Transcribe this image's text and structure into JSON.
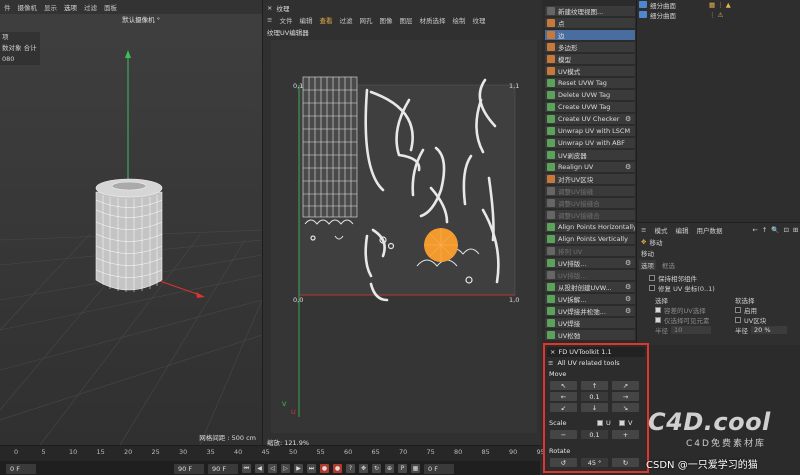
{
  "viewport": {
    "menu": [
      "件",
      "摄像机",
      "显示",
      "选项",
      "过滤",
      "面板"
    ],
    "menu_highlight_index": 3,
    "camera_label": "默认摄像机 °",
    "info_lines": [
      "项",
      "数对象  合计",
      "",
      "080"
    ],
    "grid_label": "网格间距 : 500 cm"
  },
  "timeline": {
    "ticks": [
      "0",
      "5",
      "10",
      "15",
      "20",
      "25",
      "30",
      "35",
      "40",
      "45",
      "50",
      "55",
      "60",
      "65",
      "70",
      "75",
      "80",
      "85",
      "90",
      "95"
    ],
    "start_field": "0 F",
    "end_field_1": "90 F",
    "end_field_2": "90 F",
    "current_field": "0 F"
  },
  "uv_editor": {
    "window_title": "纹理",
    "menu": [
      "文件",
      "编辑",
      "查看",
      "过滤",
      "网孔",
      "图像",
      "图层",
      "材质选择",
      "绘制",
      "纹理"
    ],
    "menu_highlight_index": 2,
    "subtitle": "纹理UV编辑器",
    "corner_tl": "0,1",
    "corner_tr": "1,1",
    "corner_bl": "0,0",
    "corner_br": "1,0",
    "zoom_label": "缩放: 121.9%",
    "axis_u": "U",
    "axis_v": "V"
  },
  "commands": [
    {
      "label": "新建纹理视图...",
      "icon": "grey",
      "state": "normal",
      "gear": false
    },
    {
      "label": "点",
      "icon": "orange",
      "state": "normal",
      "gear": false
    },
    {
      "label": "边",
      "icon": "orange",
      "state": "active",
      "gear": false
    },
    {
      "label": "多边形",
      "icon": "orange",
      "state": "normal",
      "gear": false
    },
    {
      "label": "模型",
      "icon": "orange",
      "state": "normal",
      "gear": false
    },
    {
      "label": "UV模式",
      "icon": "orange",
      "state": "normal",
      "gear": false
    },
    {
      "label": "Reset UVW Tag",
      "icon": "green",
      "state": "normal",
      "gear": false
    },
    {
      "label": "Delete UVW Tag",
      "icon": "green",
      "state": "normal",
      "gear": false
    },
    {
      "label": "Create UVW Tag",
      "icon": "green",
      "state": "normal",
      "gear": false
    },
    {
      "label": "Create UV Checker",
      "icon": "green",
      "state": "normal",
      "gear": true
    },
    {
      "label": "Unwrap UV with LSCM",
      "icon": "green",
      "state": "normal",
      "gear": false
    },
    {
      "label": "Unwrap UV with ABF",
      "icon": "green",
      "state": "normal",
      "gear": false
    },
    {
      "label": "UV剥皮器",
      "icon": "green",
      "state": "normal",
      "gear": false
    },
    {
      "label": "Realign UV",
      "icon": "green",
      "state": "normal",
      "gear": true
    },
    {
      "label": "对齐UV区块",
      "icon": "orange",
      "state": "normal",
      "gear": false
    },
    {
      "label": "调整UV接缝",
      "icon": "grey",
      "state": "disabled",
      "gear": false
    },
    {
      "label": "调整UV接缝合",
      "icon": "grey",
      "state": "disabled",
      "gear": false
    },
    {
      "label": "调整UV接缝合",
      "icon": "grey",
      "state": "disabled",
      "gear": false
    },
    {
      "label": "Align Points Horizontally",
      "icon": "green",
      "state": "normal",
      "gear": false
    },
    {
      "label": "Align Points Vertically",
      "icon": "green",
      "state": "normal",
      "gear": false
    },
    {
      "label": "排列 UV",
      "icon": "grey",
      "state": "disabled",
      "gear": false
    },
    {
      "label": "UV排版...",
      "icon": "green",
      "state": "normal",
      "gear": true
    },
    {
      "label": "UV排版...",
      "icon": "grey",
      "state": "disabled",
      "gear": false
    },
    {
      "label": "从投射创建UVW...",
      "icon": "green",
      "state": "normal",
      "gear": true
    },
    {
      "label": "UV拆解...",
      "icon": "green",
      "state": "normal",
      "gear": true
    },
    {
      "label": "UV焊接并松弛...",
      "icon": "green",
      "state": "normal",
      "gear": true
    },
    {
      "label": "UV焊接",
      "icon": "green",
      "state": "normal",
      "gear": false
    },
    {
      "label": "UV松弛",
      "icon": "green",
      "state": "normal",
      "gear": false
    }
  ],
  "object_manager": {
    "rows": [
      "细分曲面",
      "细分曲面"
    ]
  },
  "attributes": {
    "menu": [
      "模式",
      "编辑",
      "用户数据"
    ],
    "tool_title": "移动",
    "section": "移动",
    "tabs": [
      "选项",
      "框选"
    ],
    "opt1": "保持相邻组件",
    "opt2": "修复 UV 坐标(0..1)",
    "sel_header": "选择",
    "sel_opt1": "容差的UV选择",
    "sel_opt2": "仅选择可见元素",
    "sel_radius_label": "半径",
    "sel_radius_value": "10",
    "right_header": "软选择",
    "right_opt1": "启用",
    "right_opt2": "UV区块",
    "right_radius_label": "半径",
    "right_radius_value": "20 %"
  },
  "toolkit": {
    "title": "FD UVToolkit 1.1",
    "subtitle": "All UV related tools",
    "move_label": "Move",
    "move_value": "0.1",
    "scale_label": "Scale",
    "scale_value": "0.1",
    "scale_u_label": "U",
    "scale_v_label": "V",
    "rotate_label": "Rotate",
    "rotate_value": "45 °",
    "scale_minus": "−"
  },
  "watermark": {
    "main": "C4D.cool",
    "sub": "C4D免费素材库",
    "credit": "CSDN @一只爱学习的猫"
  },
  "colors": {
    "accent_red": "#e0352b",
    "active_blue": "#4a6da0",
    "orange_disc": "#f29a2e",
    "menu_highlight": "#e9b44c"
  }
}
